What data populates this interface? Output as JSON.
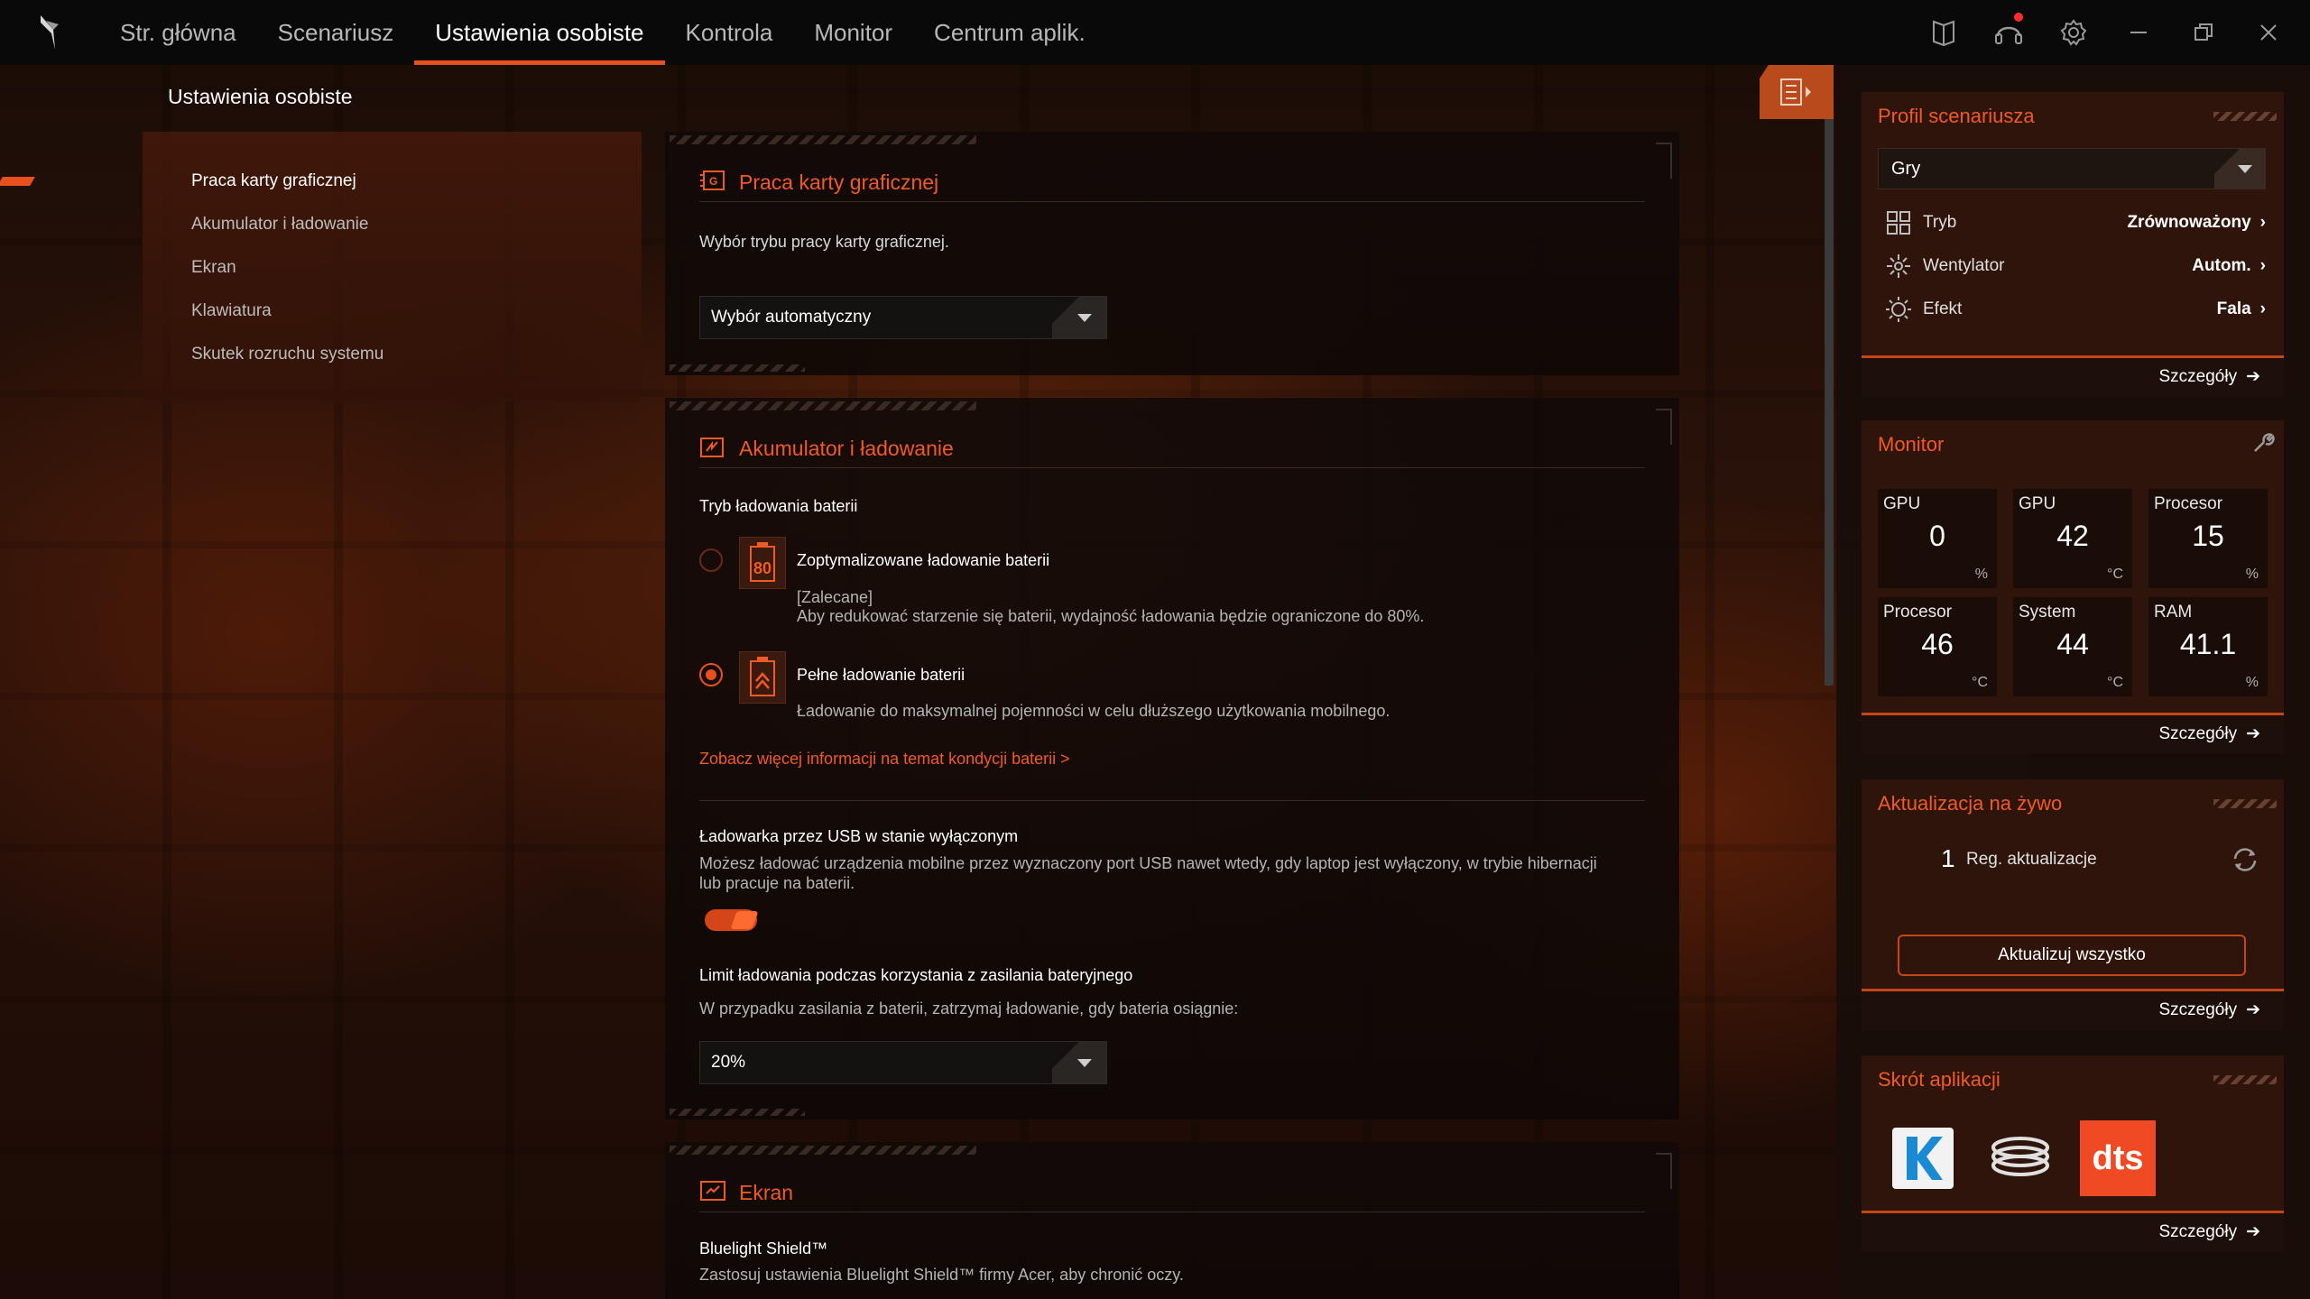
{
  "nav": {
    "tabs": [
      "Str. główna",
      "Scenariusz",
      "Ustawienia osobiste",
      "Kontrola",
      "Monitor",
      "Centrum aplik."
    ],
    "active_index": 2
  },
  "page": {
    "title": "Ustawienia osobiste"
  },
  "sidebar": {
    "items": [
      "Praca karty graficznej",
      "Akumulator i ładowanie",
      "Ekran",
      "Klawiatura",
      "Skutek rozruchu systemu"
    ],
    "active_index": 0
  },
  "gpu_card": {
    "title": "Praca karty graficznej",
    "description": "Wybór trybu pracy karty graficznej.",
    "select_value": "Wybór automatyczny"
  },
  "battery_card": {
    "title": "Akumulator i ładowanie",
    "charge_mode_label": "Tryb ładowania baterii",
    "option1_title": "Zoptymalizowane ładowanie baterii",
    "option1_badge": "80",
    "option1_note": "[Zalecane]",
    "option1_desc": "Aby redukować starzenie się baterii, wydajność ładowania będzie ograniczone do 80%.",
    "option2_title": "Pełne ładowanie baterii",
    "option2_desc": "Ładowanie do maksymalnej pojemności w celu dłuższego użytkowania mobilnego.",
    "selected_option": 2,
    "more_info_link": "Zobacz więcej informacji na temat kondycji baterii >",
    "usb_title": "Ładowarka przez USB w stanie wyłączonym",
    "usb_desc": "Możesz ładować urządzenia mobilne przez wyznaczony port USB nawet wtedy, gdy laptop jest wyłączony, w trybie hibernacji lub pracuje na baterii.",
    "usb_enabled": true,
    "limit_title": "Limit ładowania podczas korzystania z zasilania bateryjnego",
    "limit_desc": "W przypadku zasilania z baterii, zatrzymaj ładowanie, gdy bateria osiągnie:",
    "limit_value": "20%"
  },
  "screen_card": {
    "title": "Ekran",
    "bluelight_title": "Bluelight Shield™",
    "bluelight_desc": "Zastosuj ustawienia Bluelight Shield™ firmy Acer, aby chronić oczy."
  },
  "profile": {
    "title": "Profil scenariusza",
    "selected": "Gry",
    "rows": [
      {
        "label": "Tryb",
        "value": "Zrównoważony",
        "icon": "grid-icon"
      },
      {
        "label": "Wentylator",
        "value": "Autom.",
        "icon": "fan-icon"
      },
      {
        "label": "Efekt",
        "value": "Fala",
        "icon": "sun-icon"
      }
    ],
    "details": "Szczegóły"
  },
  "monitor": {
    "title": "Monitor",
    "tiles": [
      {
        "label": "GPU",
        "value": "0",
        "unit": "%"
      },
      {
        "label": "GPU",
        "value": "42",
        "unit": "°C"
      },
      {
        "label": "Procesor",
        "value": "15",
        "unit": "%"
      },
      {
        "label": "Procesor",
        "value": "46",
        "unit": "°C"
      },
      {
        "label": "System",
        "value": "44",
        "unit": "°C"
      },
      {
        "label": "RAM",
        "value": "41.1",
        "unit": "%"
      }
    ],
    "details": "Szczegóły"
  },
  "live_update": {
    "title": "Aktualizacja na żywo",
    "count": "1",
    "label": "Reg. aktualizacje",
    "button": "Aktualizuj wszystko",
    "details": "Szczegóły"
  },
  "app_shortcut": {
    "title": "Skrót aplikacji",
    "apps": [
      "K",
      "",
      "dts"
    ],
    "details": "Szczegóły"
  },
  "colors": {
    "accent": "#e8501e",
    "accent_text": "#f05a24",
    "topbar": "#090909"
  }
}
